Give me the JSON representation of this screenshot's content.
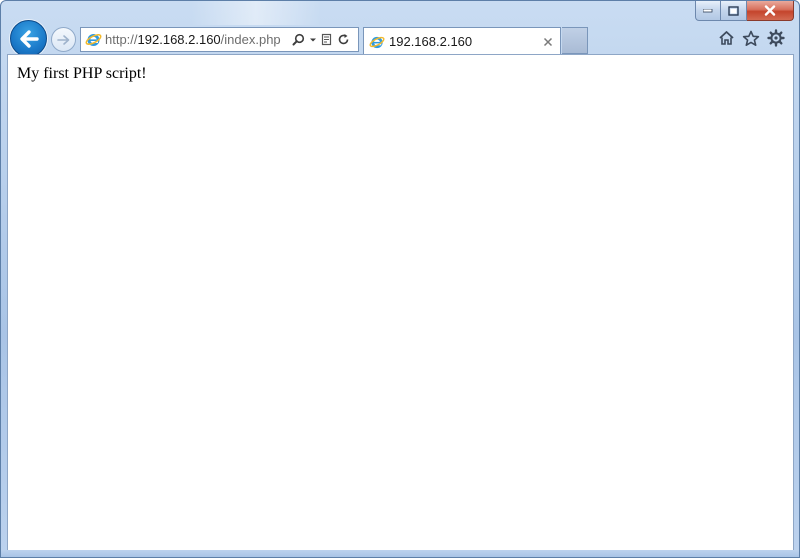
{
  "address_bar": {
    "url_scheme": "http://",
    "url_host": "192.168.2.160",
    "url_path": "/index.php"
  },
  "tab": {
    "title": "192.168.2.160"
  },
  "page": {
    "body_text": "My first PHP script!"
  },
  "icons": {
    "back": "back-arrow-icon",
    "forward": "forward-arrow-icon",
    "site": "internet-explorer-icon",
    "search": "search-icon",
    "dropdown": "chevron-down-icon",
    "compat": "compatibility-view-icon",
    "refresh": "refresh-icon",
    "close_tab": "close-icon",
    "home": "home-icon",
    "favorites": "star-icon",
    "tools": "gear-icon",
    "minimize": "minimize-icon",
    "maximize": "restore-icon",
    "close_window": "close-icon"
  },
  "colors": {
    "frame": "#b9d0ec",
    "back_button": "#1a78c8",
    "close_button": "#c4442c"
  }
}
